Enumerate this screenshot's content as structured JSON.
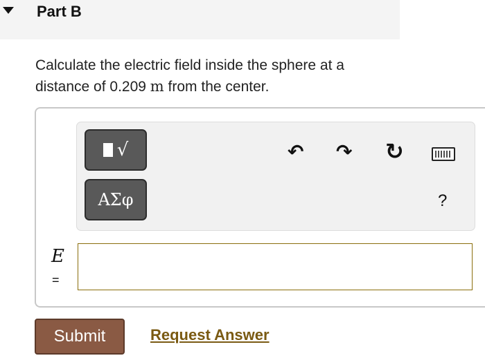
{
  "part": {
    "title": "Part B"
  },
  "question": {
    "line1": "Calculate the electric field inside the sphere at a",
    "line2_pre": "distance of 0.209 ",
    "line2_unit": "m",
    "line2_post": " from the center."
  },
  "toolbar": {
    "templates_root": "√",
    "symbols_label": "ΑΣφ",
    "undo_glyph": "↶",
    "redo_glyph": "↷",
    "reset_glyph": "↻",
    "help_label": "?"
  },
  "answer": {
    "variable": "E",
    "equals": "=",
    "value": ""
  },
  "actions": {
    "submit_label": "Submit",
    "request_label": "Request Answer"
  }
}
